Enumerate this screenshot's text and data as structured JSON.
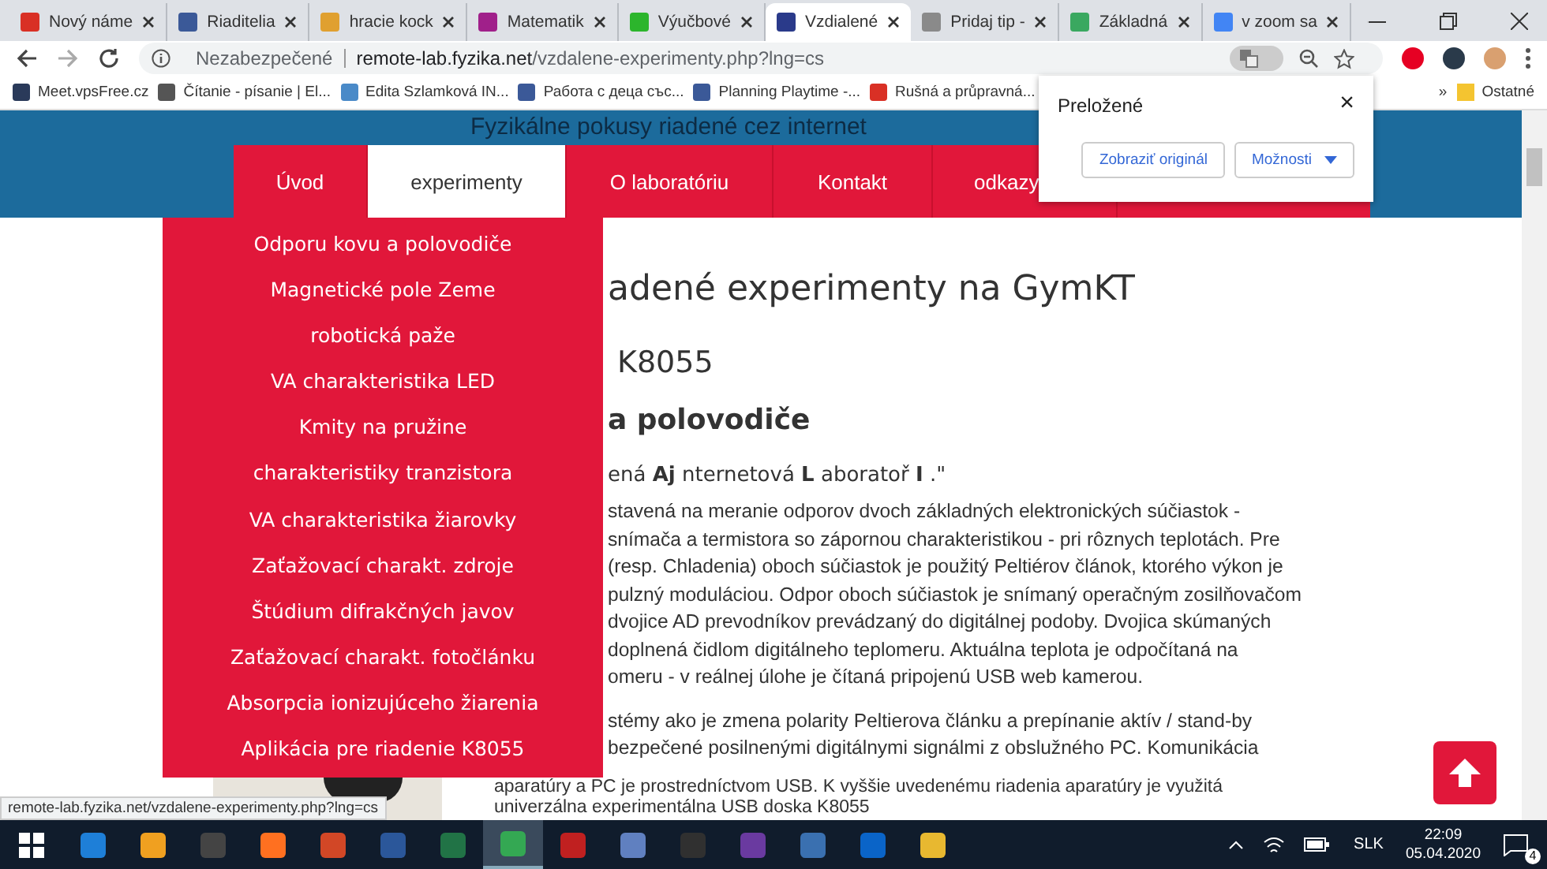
{
  "tabs": [
    {
      "label": "Nový náme",
      "selected": false,
      "color": "#d93025"
    },
    {
      "label": "Riaditelia",
      "selected": false,
      "color": "#3b5998"
    },
    {
      "label": "hracie kock",
      "selected": false,
      "color": "#e0a030"
    },
    {
      "label": "Matematik",
      "selected": false,
      "color": "#a0208a"
    },
    {
      "label": "Výučbové",
      "selected": false,
      "color": "#2cb52c"
    },
    {
      "label": "Vzdialené",
      "selected": true,
      "color": "#2a3a8a"
    },
    {
      "label": "Pridaj tip -",
      "selected": false,
      "color": "#8a8a8a"
    },
    {
      "label": "Základná",
      "selected": false,
      "color": "#3aa860"
    },
    {
      "label": "v zoom sa",
      "selected": false,
      "color": "#4285f4"
    }
  ],
  "address_bar": {
    "security": "Nezabezpečené",
    "host": "remote-lab.fyzika.net",
    "path": "/vzdalene-experimenty.php?lng=cs"
  },
  "bookmarks": [
    {
      "label": "Meet.vpsFree.cz",
      "color": "#2a3a5a"
    },
    {
      "label": "Čítanie - písanie | El...",
      "color": "#555555"
    },
    {
      "label": "Edita Szlamková IN...",
      "color": "#4a8ac8"
    },
    {
      "label": "Работа с деца със...",
      "color": "#3b5998"
    },
    {
      "label": "Planning Playtime -...",
      "color": "#3b5998"
    },
    {
      "label": "Rušná a průpravná...",
      "color": "#d93025"
    }
  ],
  "bookmarks_more": "»",
  "bookmarks_other": "Ostatné",
  "translate_popup": {
    "title": "Preložené",
    "close": "×",
    "buttons": [
      "Zobraziť originál",
      "Možnosti"
    ]
  },
  "site": {
    "title": "Fyzikálne pokusy riadené cez internet",
    "nav": [
      {
        "label": "Úvod",
        "selected": false
      },
      {
        "label": "experimenty",
        "selected": true
      },
      {
        "label": "O laboratóriu",
        "selected": false
      },
      {
        "label": "Kontakt",
        "selected": false
      },
      {
        "label": "odkazy",
        "selected": false
      }
    ],
    "menu": [
      "Odporu kovu a polovodiče",
      "Magnetické pole Zeme",
      "robotická paže",
      "VA charakteristika LED",
      "Kmity na pružine",
      "charakteristiky tranzistora",
      "VA charakteristika žiarovky",
      "Zaťažovací charakt. zdroje",
      "Štúdium difrakčných javov",
      "Zaťažovací charakt. fotočlánku",
      "Absorpcia ionizujúceho žiarenia",
      "Aplikácia pre riadenie K8055"
    ],
    "heading": "adené experimenty na GymKT",
    "subheading": "K8055",
    "section_title": "a polovodiče",
    "quote": "ená **Aj** nternetová **L** aboratoř **I** .\"",
    "paragraph_1": [
      "stavená na meranie odporov dvoch základných elektronických súčiastok -",
      "snímača a termistora so zápornou charakteristikou - pri rôznych teplotách. Pre",
      "(resp. Chladenia) oboch súčiastok je použitý Peltiérov článok, ktorého výkon je",
      "pulzný moduláciou. Odpor oboch súčiastok je snímaný operačným zosilňovačom",
      "dvojice AD prevodníkov prevádzaný do digitálnej podoby. Dvojica skúmaných",
      "doplnená čidlom digitálneho teplomeru. Aktuálna teplota je odpočítaná na",
      "omeru - v reálnej úlohe je čítaná pripojenú USB web kamerou."
    ],
    "paragraph_2": [
      "stémy ako je zmena polarity Peltierova článku a prepínanie aktív / stand-by",
      "bezpečené posilnenými digitálnymi signálmi z obslužného PC. Komunikácia"
    ],
    "paragraph_2_below": [
      "aparatúry a PC je prostredníctvom USB. K vyššie uvedenému riadenia aparatúry je využitá",
      "univerzálna experimentálna USB doska K8055"
    ]
  },
  "status_url": "remote-lab.fyzika.net/vzdalene-experimenty.php?lng=cs",
  "taskbar": {
    "apps": [
      {
        "color": "#1e7fd8",
        "selected": false
      },
      {
        "color": "#f0a020",
        "selected": false
      },
      {
        "color": "#444444",
        "selected": false
      },
      {
        "color": "#ff7020",
        "selected": false
      },
      {
        "color": "#d24726",
        "selected": false
      },
      {
        "color": "#2b579a",
        "selected": false
      },
      {
        "color": "#217346",
        "selected": false
      },
      {
        "color": "#34a853",
        "selected": true
      },
      {
        "color": "#c02020",
        "selected": false
      },
      {
        "color": "#6080c0",
        "selected": false
      },
      {
        "color": "#303030",
        "selected": false
      },
      {
        "color": "#6a3aa0",
        "selected": false
      },
      {
        "color": "#3a70b0",
        "selected": false
      },
      {
        "color": "#0a64c8",
        "selected": false
      },
      {
        "color": "#e8b830",
        "selected": false
      }
    ],
    "language": "SLK",
    "time": "22:09",
    "date": "05.04.2020",
    "notifications": "4"
  }
}
